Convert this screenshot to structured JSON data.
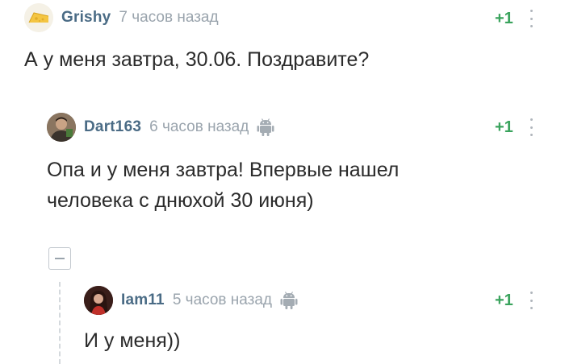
{
  "comments": [
    {
      "username": "Grishy",
      "time": "7 часов назад",
      "rating": "+1",
      "text": "А у меня завтра, 30.06. Поздравите?",
      "avatar_icon": "cheese-avatar-icon"
    },
    {
      "username": "Dart163",
      "time": "6 часов назад",
      "rating": "+1",
      "text": "Опа и у меня завтра! Впервые нашел человека с днюхой 30 июня)",
      "text_line1": "Опа и у меня завтра! Впервые нашел",
      "text_line2": "человека с днюхой 30 июня)",
      "device_icon": "android-icon"
    },
    {
      "username": "Iam11",
      "time": "5 часов назад",
      "rating": "+1",
      "text": "И у меня))",
      "device_icon": "android-icon"
    }
  ],
  "colors": {
    "username": "#4a6b85",
    "time": "#9aa4ad",
    "rating": "#3aa35d",
    "text": "#2b2b2b"
  }
}
